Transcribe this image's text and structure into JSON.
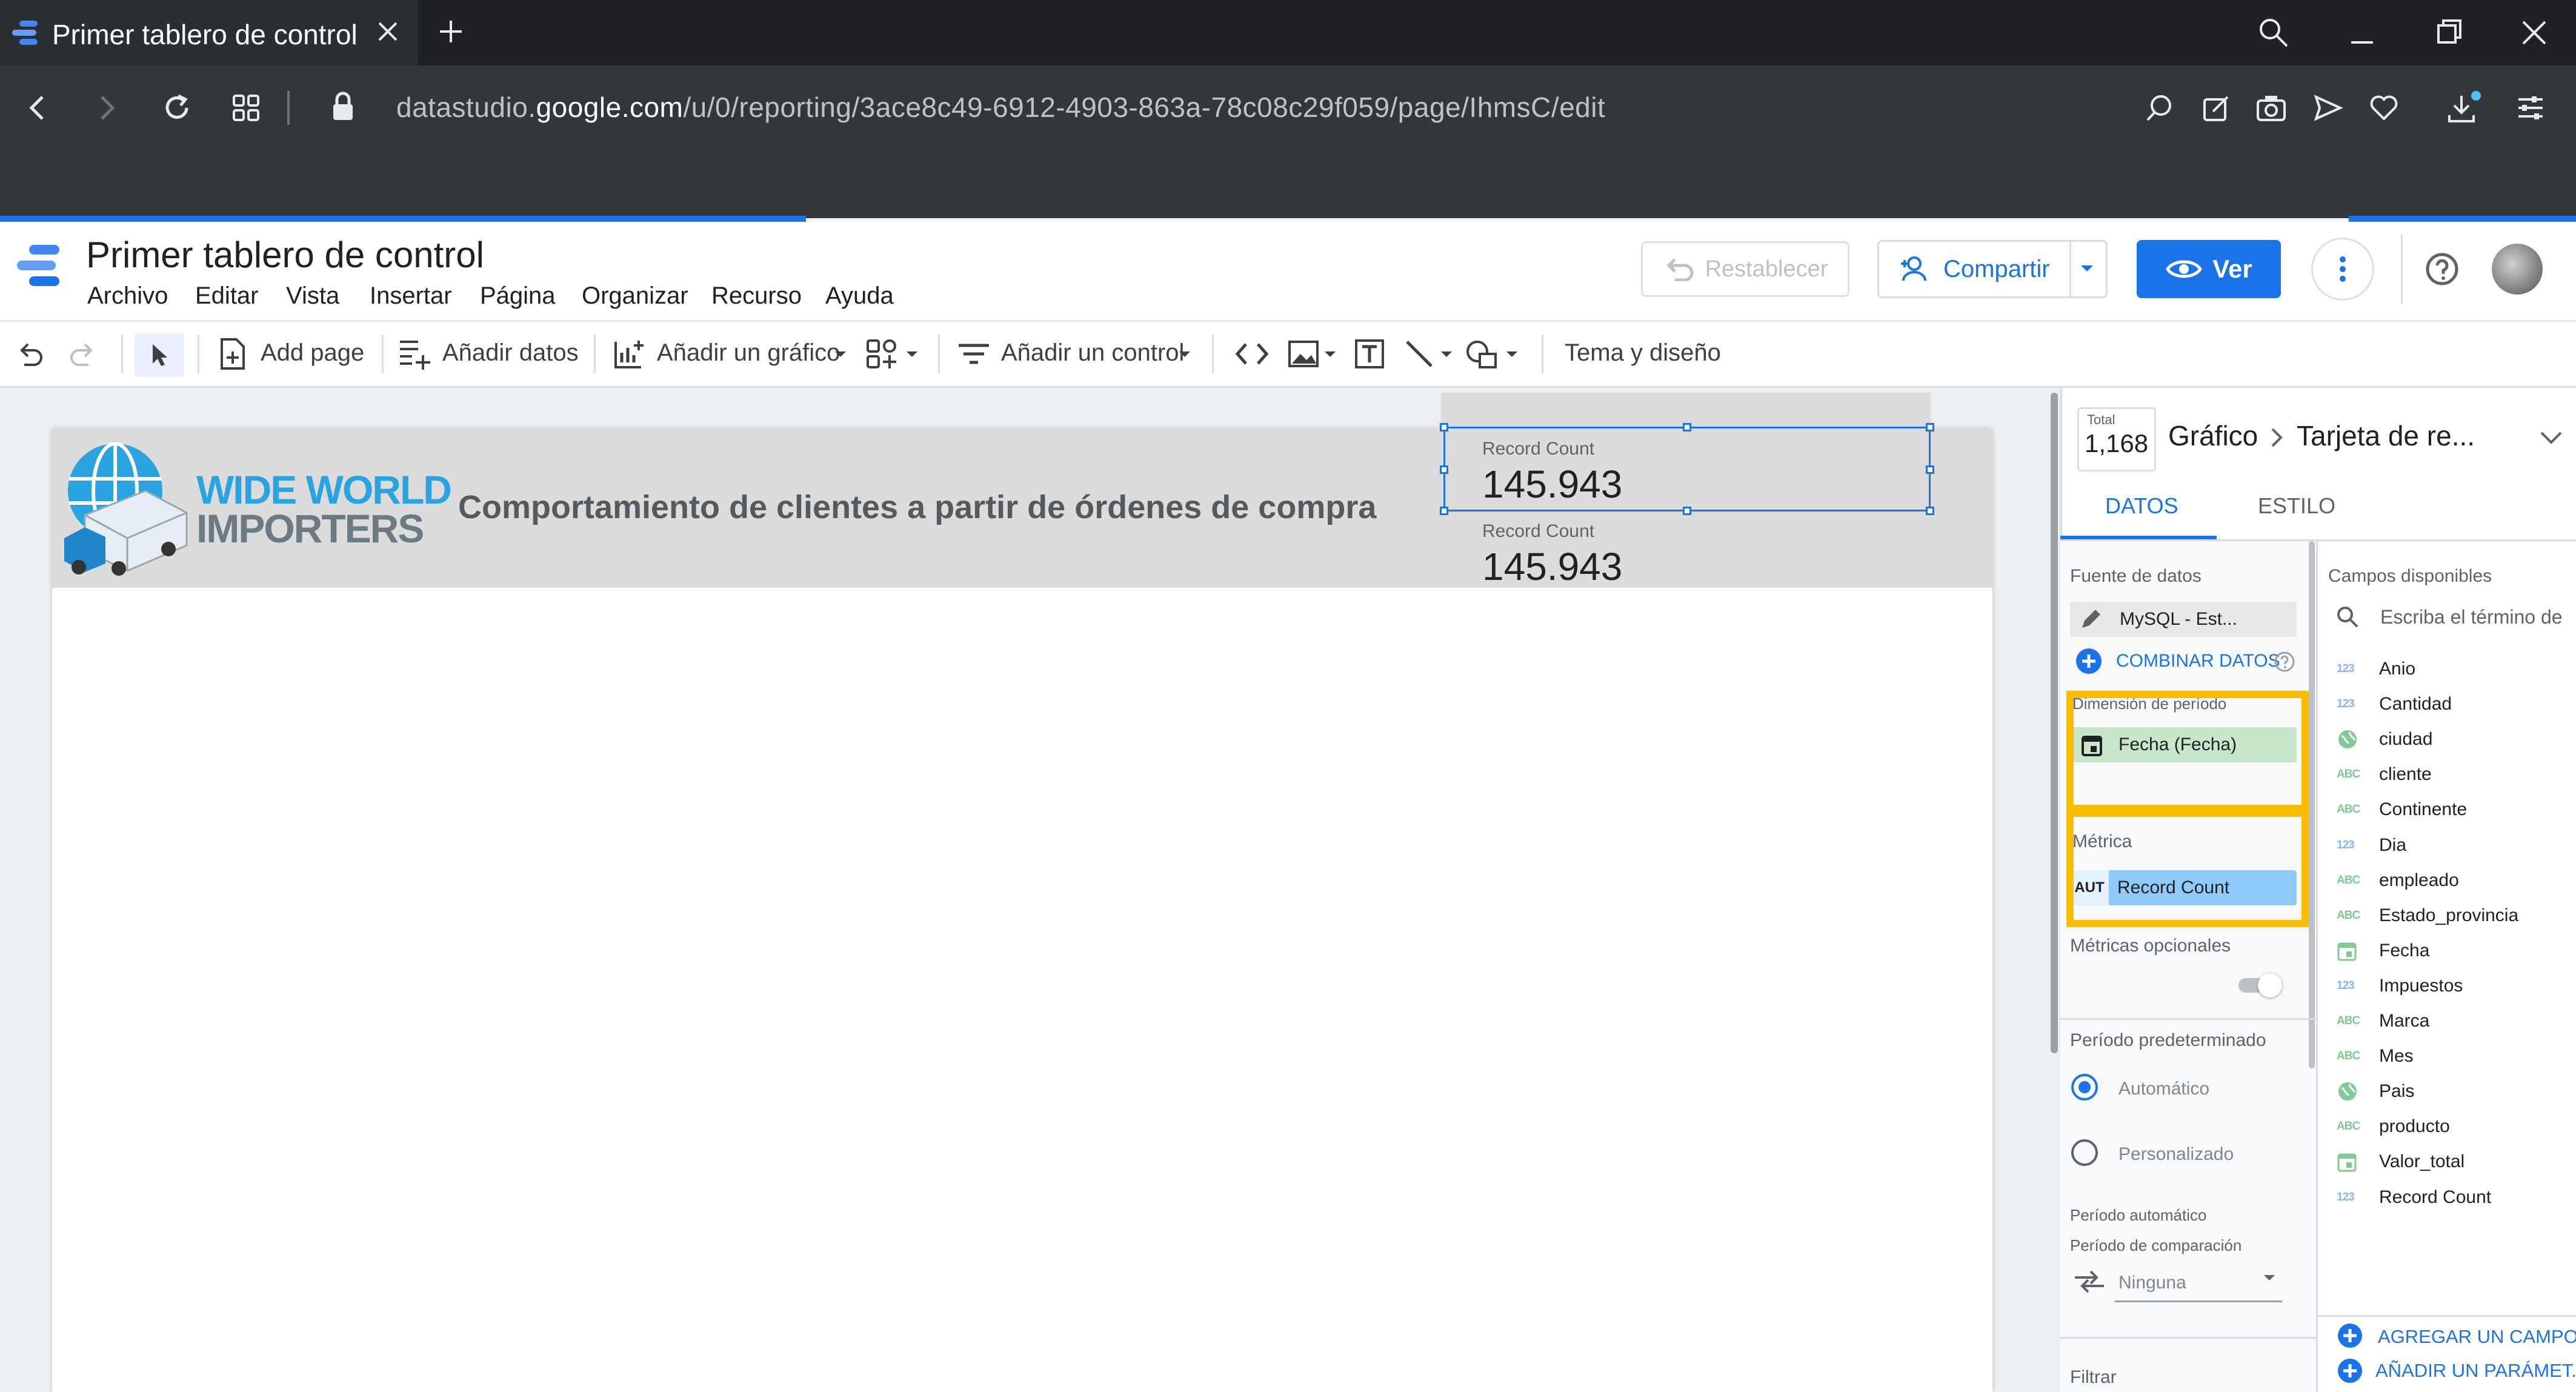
{
  "browser": {
    "tab_title": "Primer tablero de control",
    "url_prefix": "datastudio.",
    "url_domain": "google.com",
    "url_path": "/u/0/reporting/3ace8c49-6912-4903-863a-78c08c29f059/page/IhmsC/edit"
  },
  "app": {
    "title": "Primer tablero de control",
    "menu": [
      "Archivo",
      "Editar",
      "Vista",
      "Insertar",
      "Página",
      "Organizar",
      "Recurso",
      "Ayuda"
    ],
    "restore_label": "Restablecer",
    "share_label": "Compartir",
    "view_label": "Ver"
  },
  "toolbar": {
    "add_page": "Add page",
    "add_data": "Añadir datos",
    "add_chart": "Añadir un gráfico",
    "add_control": "Añadir un control",
    "theme": "Tema y diseño"
  },
  "report": {
    "brand_line1": "WIDE WORLD",
    "brand_line2": "IMPORTERS",
    "title": "Comportamiento de clientes a partir de órdenes de compra",
    "scorecards": [
      {
        "label": "Record Count",
        "value": "145.943"
      },
      {
        "label": "Record Count",
        "value": "145.943"
      }
    ]
  },
  "panel": {
    "total_label": "Total",
    "total_value": "1,168",
    "breadcrumb_1": "Gráfico",
    "breadcrumb_2": "Tarjeta de re...",
    "tabs": [
      "DATOS",
      "ESTILO"
    ],
    "data_source_label": "Fuente de datos",
    "data_source_value": "MySQL - Est...",
    "combine_label": "COMBINAR DATOS",
    "date_dimension_label": "Dimensión de período",
    "date_dimension_value": "Fecha (Fecha)",
    "metric_label": "Métrica",
    "metric_type": "AUT",
    "metric_value": "Record Count",
    "optional_metrics_label": "Métricas opcionales",
    "default_period_label": "Período predeterminado",
    "period_automatic": "Automático",
    "period_custom": "Personalizado",
    "automatic_period_label": "Período automático",
    "comparison_label": "Período de comparación",
    "comparison_value": "Ninguna",
    "filter_label": "Filtrar",
    "fields_title": "Campos disponibles",
    "search_placeholder": "Escriba el término de",
    "fields": [
      {
        "type": "123",
        "name": "Anio"
      },
      {
        "type": "123",
        "name": "Cantidad"
      },
      {
        "type": "geo",
        "name": "ciudad"
      },
      {
        "type": "ABC",
        "name": "cliente"
      },
      {
        "type": "ABC",
        "name": "Continente"
      },
      {
        "type": "123",
        "name": "Dia"
      },
      {
        "type": "ABC",
        "name": "empleado"
      },
      {
        "type": "ABC",
        "name": "Estado_provincia"
      },
      {
        "type": "date",
        "name": "Fecha"
      },
      {
        "type": "123",
        "name": "Impuestos"
      },
      {
        "type": "ABC",
        "name": "Marca"
      },
      {
        "type": "ABC",
        "name": "Mes"
      },
      {
        "type": "geo",
        "name": "Pais"
      },
      {
        "type": "ABC",
        "name": "producto"
      },
      {
        "type": "date",
        "name": "Valor_total"
      },
      {
        "type": "123",
        "name": "Record Count"
      }
    ],
    "add_field_label": "AGREGAR UN CAMPO",
    "add_param_label": "AÑADIR UN PARÁMET..."
  },
  "colors": {
    "accent": "#1a73e8",
    "highlight": "#fbbc04",
    "metric_chip": "#90caf9",
    "date_chip": "#c8e6c9",
    "brand_blue": "#2aa4e0"
  }
}
